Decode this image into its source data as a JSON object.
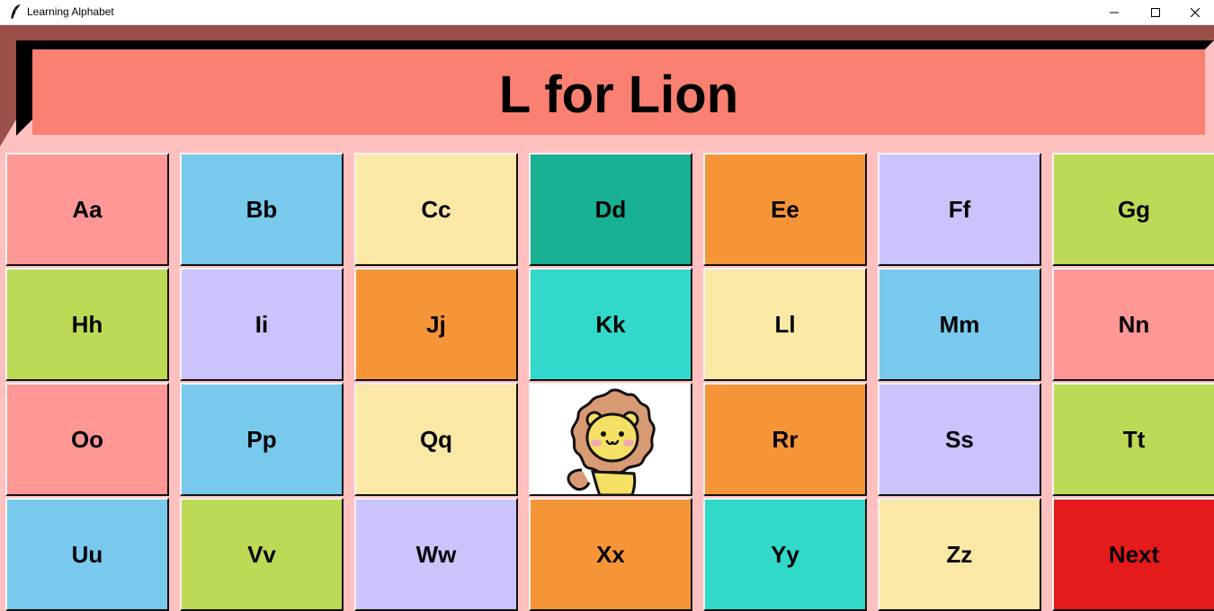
{
  "window": {
    "title": "Learning Alphabet",
    "controls": {
      "minimize": "minimize-icon",
      "maximize": "maximize-icon",
      "close": "close-icon"
    }
  },
  "banner": {
    "text": "L for Lion",
    "color": "#fa8072"
  },
  "tiles": [
    {
      "label": "Aa",
      "color": "#ff9797"
    },
    {
      "label": "Bb",
      "color": "#79c9ed"
    },
    {
      "label": "Cc",
      "color": "#fbe8a6"
    },
    {
      "label": "Dd",
      "color": "#17b092"
    },
    {
      "label": "Ee",
      "color": "#f69538"
    },
    {
      "label": "Ff",
      "color": "#cbc3fc"
    },
    {
      "label": "Gg",
      "color": "#bdda57"
    },
    {
      "label": "Hh",
      "color": "#bdda57"
    },
    {
      "label": "Ii",
      "color": "#cbc3fc"
    },
    {
      "label": "Jj",
      "color": "#f69538"
    },
    {
      "label": "Kk",
      "color": "#32d9ca"
    },
    {
      "label": "Ll",
      "color": "#fbe8a6"
    },
    {
      "label": "Mm",
      "color": "#79c9ed"
    },
    {
      "label": "Nn",
      "color": "#ff9797"
    },
    {
      "label": "Oo",
      "color": "#ff9797"
    },
    {
      "label": "Pp",
      "color": "#79c9ed"
    },
    {
      "label": "Qq",
      "color": "#fbe8a6"
    },
    {
      "label": "",
      "color": "#ffffff",
      "image": "lion-image"
    },
    {
      "label": "Rr",
      "color": "#f69538"
    },
    {
      "label": "Ss",
      "color": "#cbc3fc"
    },
    {
      "label": "Tt",
      "color": "#bdda57"
    },
    {
      "label": "Uu",
      "color": "#79c9ed"
    },
    {
      "label": "Vv",
      "color": "#bdda57"
    },
    {
      "label": "Ww",
      "color": "#cbc3fc"
    },
    {
      "label": "Xx",
      "color": "#f69538"
    },
    {
      "label": "Yy",
      "color": "#32d9ca"
    },
    {
      "label": "Zz",
      "color": "#fbe8a6"
    },
    {
      "label": "Next",
      "color": "#e51a1a"
    }
  ]
}
